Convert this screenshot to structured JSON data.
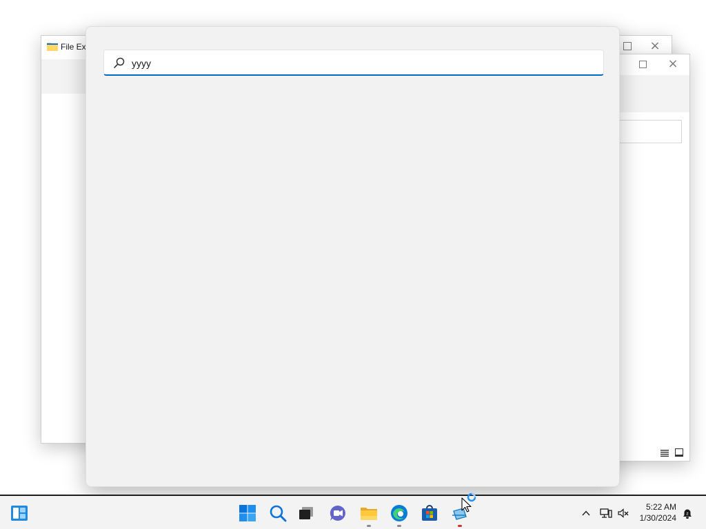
{
  "windows": {
    "explorer": {
      "title": "File Exp"
    }
  },
  "search": {
    "query": "yyyy"
  },
  "taskbar": {
    "pinned": [
      "windows-start-icon",
      "search-icon",
      "task-view-icon",
      "chat-icon",
      "file-explorer-icon",
      "edge-icon",
      "store-icon",
      "network-app-icon"
    ],
    "clock": {
      "time": "5:22 AM",
      "date": "1/30/2024"
    },
    "accent": "#0067c0"
  }
}
